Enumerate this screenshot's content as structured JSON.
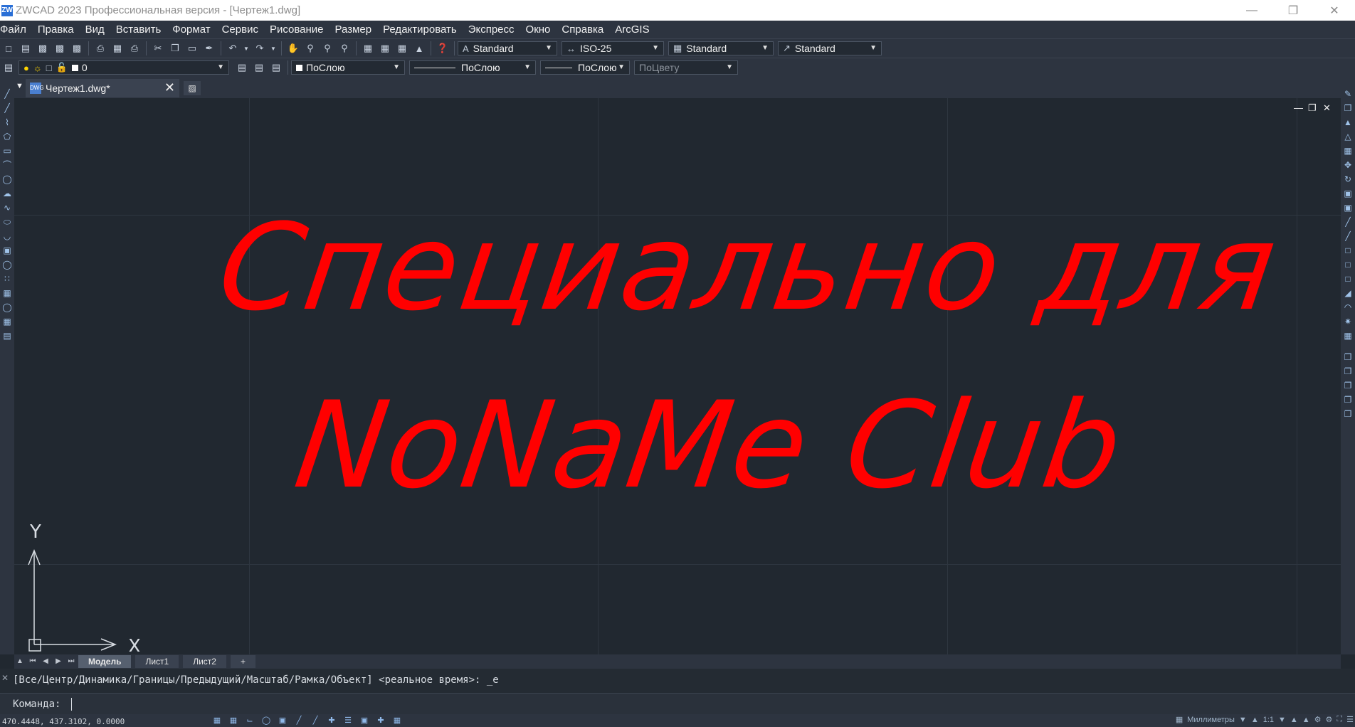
{
  "window": {
    "title": "ZWCAD 2023 Профессиональная версия - [Чертеж1.dwg]",
    "app_icon": "ZW"
  },
  "menu": [
    "Файл",
    "Правка",
    "Вид",
    "Вставить",
    "Формат",
    "Сервис",
    "Рисование",
    "Размер",
    "Редактировать",
    "Экспресс",
    "Окно",
    "Справка",
    "ArcGIS"
  ],
  "toolbar_styles": {
    "text_style": "Standard",
    "dim_style": "ISO-25",
    "table_style": "Standard",
    "mleader_style": "Standard"
  },
  "layer_bar": {
    "layer_name": "0",
    "color": "ПоСлою",
    "linetype": "ПоСлою",
    "lineweight": "ПоСлою",
    "plotstyle": "ПоЦвету"
  },
  "document_tab": {
    "label": "Чертеж1.dwg*",
    "icon": "dwg-file-icon"
  },
  "canvas": {
    "line1": "Специально для",
    "line2": "NoNaMe Club",
    "text_color": "#ff0000",
    "ucs_x": "X",
    "ucs_y": "Y"
  },
  "layout_tabs": [
    "Модель",
    "Лист1",
    "Лист2",
    "+"
  ],
  "command": {
    "history": "[Все/Центр/Динамика/Границы/Предыдущий/Масштаб/Рамка/Объект] <реальное время>: _e",
    "prompt": "Команда:"
  },
  "status": {
    "coords": "470.4448, 437.3102, 0.0000",
    "units": "Миллиметры",
    "scale": "1:1"
  }
}
